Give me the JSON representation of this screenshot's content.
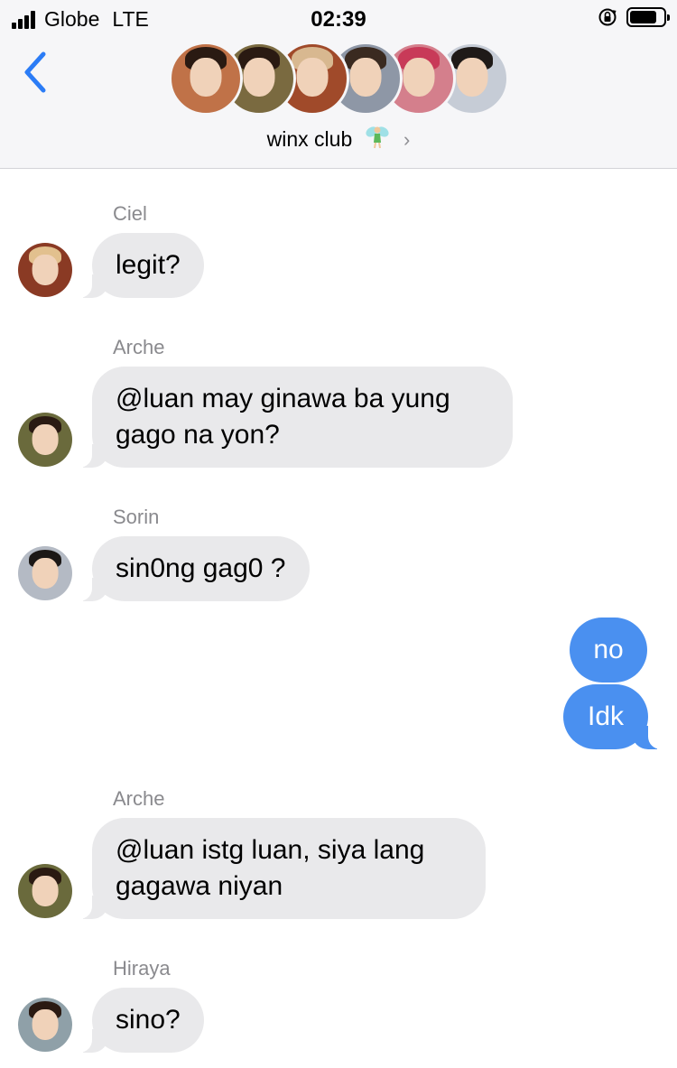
{
  "status_bar": {
    "carrier": "Globe",
    "network": "LTE",
    "time": "02:39",
    "battery_level": 0.8
  },
  "header": {
    "group_name": "winx club",
    "group_emoji": "fairy-icon",
    "participants": [
      {
        "name": "participant-1",
        "bg": "#c07248",
        "hair": "#2a1a12"
      },
      {
        "name": "participant-2",
        "bg": "#7a6a40",
        "hair": "#2a1a12"
      },
      {
        "name": "participant-3",
        "bg": "#a04a2a",
        "hair": "#d8b890"
      },
      {
        "name": "participant-4",
        "bg": "#8e97a6",
        "hair": "#3a2a20"
      },
      {
        "name": "participant-5",
        "bg": "#d47f8c",
        "hair": "#c83a58"
      },
      {
        "name": "participant-6",
        "bg": "#c6ccd6",
        "hair": "#1f1a18"
      }
    ]
  },
  "messages": [
    {
      "sender": "Ciel",
      "text": "legit?",
      "avatar_bg": "#8a3a24",
      "avatar_hair": "#e2c08e"
    },
    {
      "sender": "Arche",
      "text": "@luan may ginawa ba yung gago na yon?",
      "avatar_bg": "#6a6a3c",
      "avatar_hair": "#2a1a12"
    },
    {
      "sender": "Sorin",
      "text": "sin0ng gag0 ?",
      "avatar_bg": "#b4bac4",
      "avatar_hair": "#1c1816"
    },
    {
      "outgoing": [
        "no",
        "Idk"
      ]
    },
    {
      "sender": "Arche",
      "text": "@luan istg luan, siya lang gagawa niyan",
      "avatar_bg": "#6a6a3c",
      "avatar_hair": "#2a1a12"
    },
    {
      "sender": "Hiraya",
      "text": "sino?",
      "avatar_bg": "#8fa0a8",
      "avatar_hair": "#2a1a12"
    }
  ],
  "colors": {
    "incoming_bubble": "#e9e9eb",
    "outgoing_bubble": "#4a90f0",
    "accent": "#2b7cf6"
  }
}
